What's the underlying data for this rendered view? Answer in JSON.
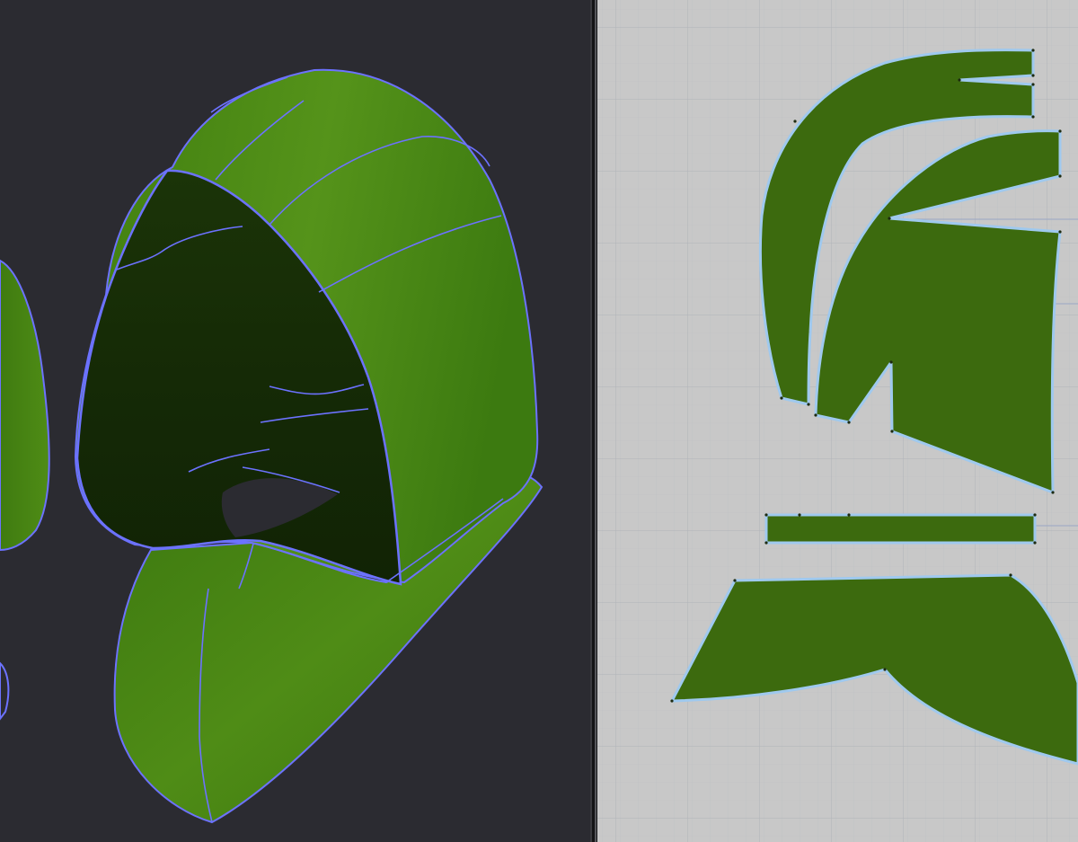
{
  "viewports": {
    "left": {
      "kind": "3D garment view",
      "background": "#2b2b31",
      "garment_color": "#4a8a12",
      "seam_color": "#6c72ff"
    },
    "right": {
      "kind": "2D pattern view",
      "background": "#c8c8c8",
      "grid_color": "#b9bcc2",
      "pattern_color": "#3c6a0e",
      "outline_color": "#9fc9ee"
    }
  },
  "pattern_pieces": [
    {
      "id": "hood-side-top"
    },
    {
      "id": "hood-side-middle"
    },
    {
      "id": "hood-side-back"
    },
    {
      "id": "hood-strip"
    },
    {
      "id": "cowl-front"
    }
  ],
  "icons": {
    "splitter": "vertical-splitter-handle"
  }
}
